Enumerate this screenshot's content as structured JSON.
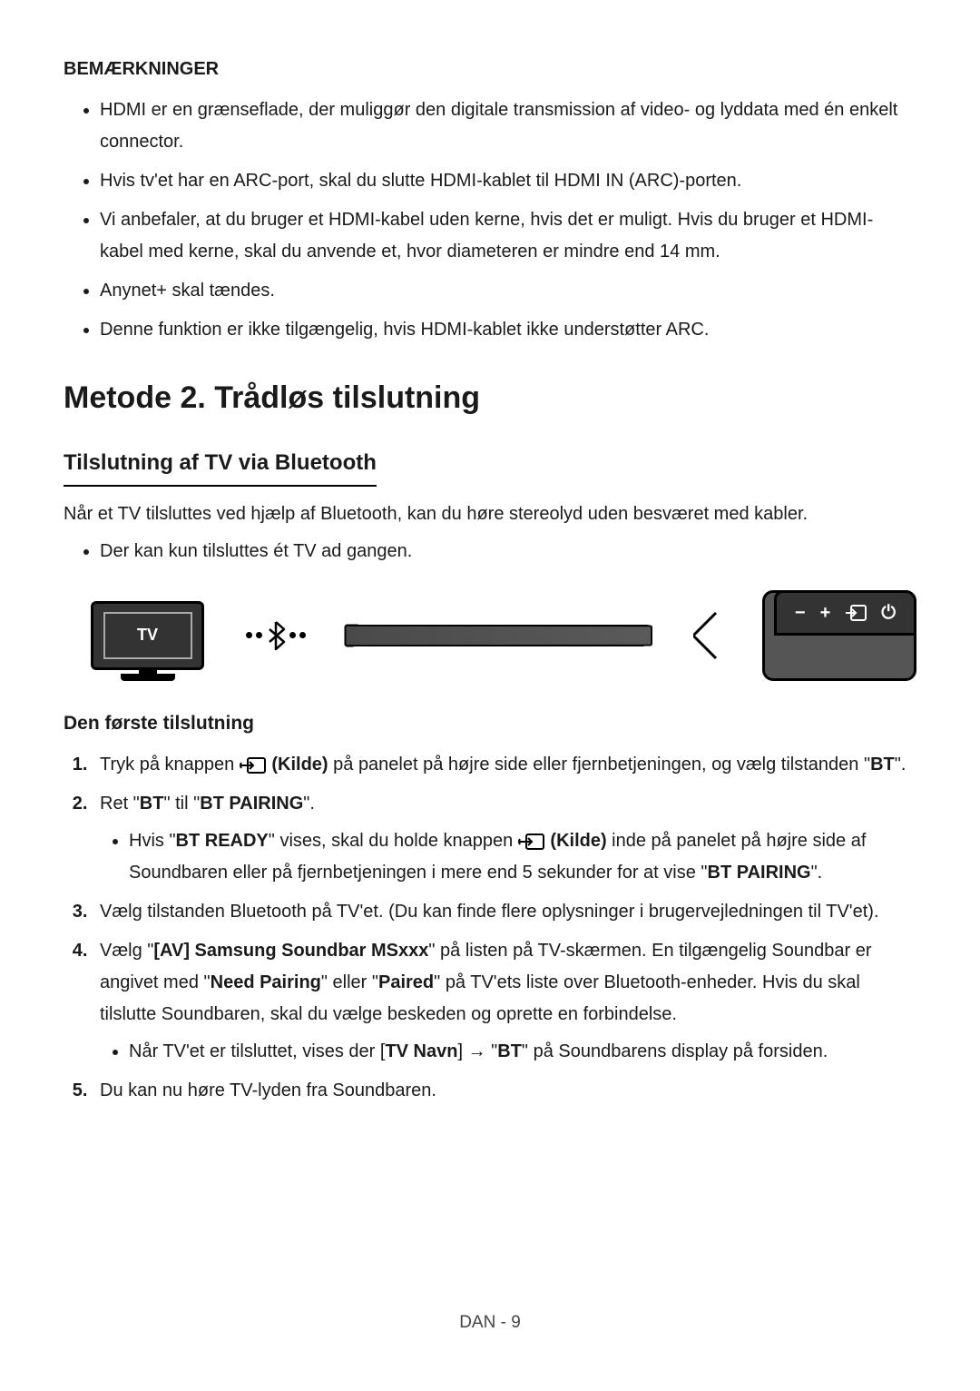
{
  "notes": {
    "heading": "BEMÆRKNINGER",
    "items": [
      "HDMI er en grænseflade, der muliggør den digitale transmission af video- og lyddata med én enkelt connector.",
      "Hvis tv'et har en ARC-port, skal du slutte HDMI-kablet til HDMI IN (ARC)-porten.",
      "Vi anbefaler, at du bruger et HDMI-kabel uden kerne, hvis det er muligt. Hvis du bruger et HDMI-kabel med kerne, skal du anvende et, hvor diameteren er mindre end 14 mm.",
      "Anynet+ skal tændes.",
      "Denne funktion er ikke tilgængelig, hvis HDMI-kablet ikke understøtter ARC."
    ]
  },
  "section": {
    "title": "Metode 2. Trådløs tilslutning",
    "subtitle": "Tilslutning af TV via Bluetooth",
    "intro": "Når et TV tilsluttes ved hjælp af Bluetooth, kan du høre stereolyd uden besværet med kabler.",
    "intro_bullet": "Der kan kun tilsluttes ét TV ad gangen."
  },
  "diagram": {
    "tv_label": "TV",
    "control_minus": "−",
    "control_plus": "+",
    "control_source": "⮐",
    "control_power": "⏻"
  },
  "steps": {
    "heading": "Den første tilslutning",
    "step1_pre": "Tryk på knappen ",
    "step1_kilde": "(Kilde)",
    "step1_post": " på panelet på højre side eller fjernbetjeningen, og vælg tilstanden \"",
    "step1_bt": "BT",
    "step1_end": "\".",
    "step2_pre": "Ret \"",
    "step2_bt": "BT",
    "step2_mid": "\" til \"",
    "step2_btpairing": "BT PAIRING",
    "step2_end": "\".",
    "step2_sub_pre": "Hvis \"",
    "step2_sub_btready": "BT READY",
    "step2_sub_mid1": "\" vises, skal du holde knappen ",
    "step2_sub_kilde": "(Kilde)",
    "step2_sub_mid2": " inde på panelet på højre side af Soundbaren eller på fjernbetjeningen i mere end 5 sekunder for at vise \"",
    "step2_sub_btpairing": "BT PAIRING",
    "step2_sub_end": "\".",
    "step3": "Vælg tilstanden Bluetooth på TV'et. (Du kan finde flere oplysninger i brugervejledningen til TV'et).",
    "step4_pre": "Vælg \"",
    "step4_av": "[AV] Samsung Soundbar MSxxx",
    "step4_mid1": "\" på listen på TV-skærmen. En tilgængelig Soundbar er angivet med \"",
    "step4_need": "Need Pairing",
    "step4_mid2": "\" eller \"",
    "step4_paired": "Paired",
    "step4_mid3": "\"  på TV'ets liste over Bluetooth-enheder. Hvis du skal tilslutte Soundbaren, skal du vælge beskeden og oprette en forbindelse.",
    "step4_sub_pre": "Når TV'et er tilsluttet, vises der [",
    "step4_sub_tvnavn": "TV Navn",
    "step4_sub_mid": "] → \"",
    "step4_sub_bt": "BT",
    "step4_sub_end": "\" på Soundbarens display på forsiden.",
    "step5": "Du kan nu høre TV-lyden fra Soundbaren."
  },
  "footer": "DAN - 9"
}
